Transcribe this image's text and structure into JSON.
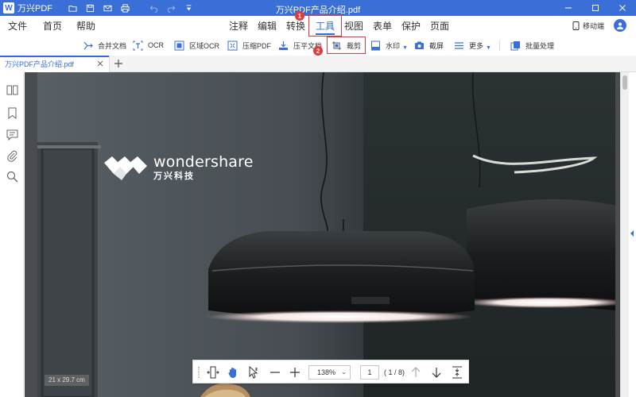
{
  "app": {
    "name": "万兴PDF",
    "window_title": "万兴PDF产品介绍.pdf",
    "accent": "#3b6fd8"
  },
  "quick_access": [
    "folder-icon",
    "save-icon",
    "mail-icon",
    "print-icon",
    "undo-icon",
    "redo-icon",
    "customize-icon"
  ],
  "menu": {
    "left": [
      {
        "label": "文件"
      },
      {
        "label": "首页"
      },
      {
        "label": "帮助"
      }
    ],
    "center": [
      {
        "label": "注释"
      },
      {
        "label": "编辑"
      },
      {
        "label": "转换"
      },
      {
        "label": "工具",
        "active": true
      },
      {
        "label": "视图"
      },
      {
        "label": "表单"
      },
      {
        "label": "保护"
      },
      {
        "label": "页面"
      }
    ],
    "mobile_label": "移动端"
  },
  "toolbar": {
    "items": [
      {
        "label": "合并文档",
        "icon": "merge-icon"
      },
      {
        "label": "OCR",
        "icon": "ocr-icon"
      },
      {
        "label": "区域OCR",
        "icon": "area-ocr-icon"
      },
      {
        "label": "压缩PDF",
        "icon": "compress-icon"
      },
      {
        "label": "压平文档",
        "icon": "flatten-icon"
      },
      {
        "label": "裁剪",
        "icon": "crop-icon"
      },
      {
        "label": "水印",
        "icon": "watermark-icon",
        "dropdown": true
      },
      {
        "label": "截屏",
        "icon": "screenshot-icon"
      },
      {
        "label": "更多",
        "icon": "more-icon",
        "dropdown": true
      },
      {
        "label": "批量处理",
        "icon": "batch-icon"
      }
    ]
  },
  "annotations": {
    "badge_1": "1",
    "badge_2": "2",
    "color": "#e23a3a"
  },
  "tabs": {
    "doc_tab_label": "万兴PDF产品介绍.pdf"
  },
  "sidebar": [
    "thumbnails-icon",
    "bookmark-icon",
    "comment-icon",
    "attachment-icon",
    "search-icon"
  ],
  "document": {
    "brand_name": "wondershare",
    "brand_sub": "万兴科技",
    "page_size_label": "21 x 29.7 cm"
  },
  "bottom_toolbar": {
    "zoom": "138%",
    "current_page": "1",
    "page_count": "( 1 / 8)"
  }
}
